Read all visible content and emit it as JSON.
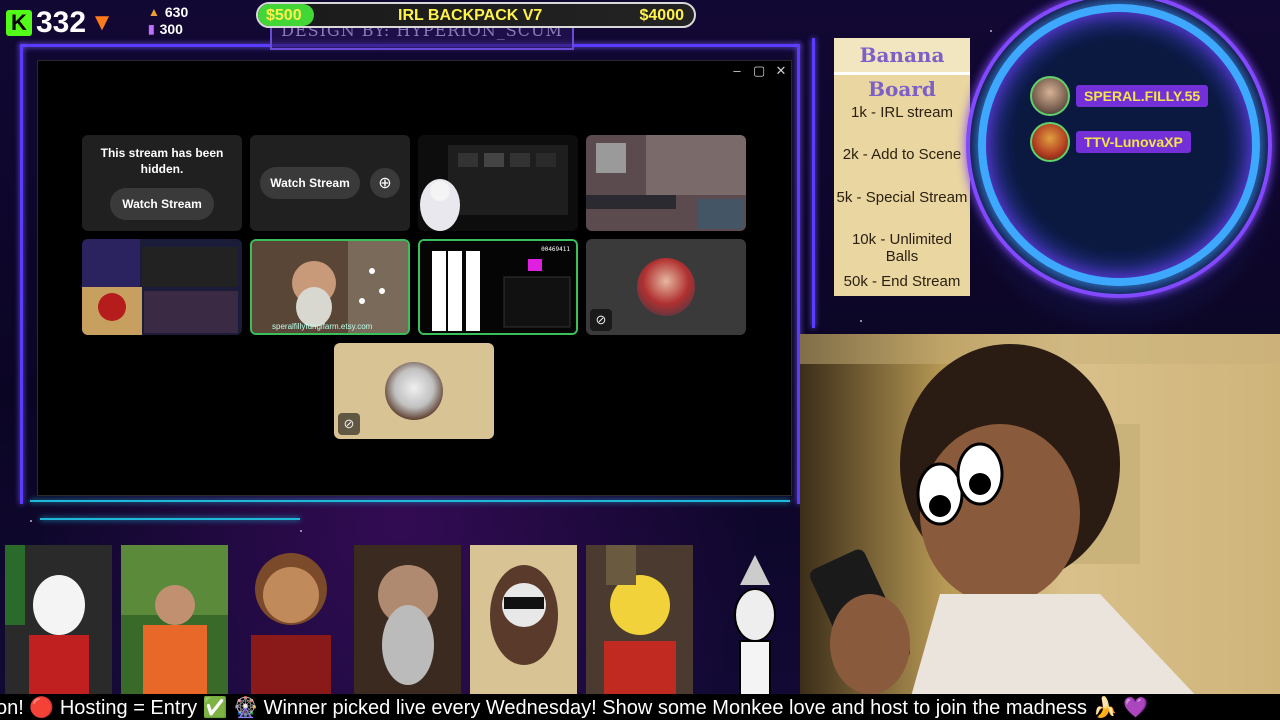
{
  "stats": {
    "kick_logo": "K",
    "viewer_count": "332",
    "trend_icon": "down-arrow",
    "stat_one": "630",
    "stat_two": "300"
  },
  "goal": {
    "start_amount": "$500",
    "title": "IRL BACKPACK V7",
    "end_amount": "$4000",
    "progress_fraction": 0.06
  },
  "credit": "DESIGN BY: HYPERION_SCUM",
  "window": {
    "controls": [
      "–",
      "▢",
      "✕"
    ],
    "hidden_tile": {
      "message": "This stream has been hidden.",
      "button_label": "Watch Stream"
    },
    "tile_two": {
      "button_label": "Watch Stream"
    },
    "etsy_caption": "speralfillyfungifarm.etsy.com",
    "overlay_number": "00469411"
  },
  "banana_board": {
    "title": "Banana Board",
    "items": [
      "1k - IRL stream",
      "2k - Add to Scene",
      "5k - Special Stream",
      "10k - Unlimited Balls",
      "50k - End Stream"
    ]
  },
  "leaderboard": [
    {
      "name": "SPERAL.FILLY.55"
    },
    {
      "name": "TTV-LunovaXP"
    }
  ],
  "ticker_text": "on! 🔴 Hosting = Entry ✅ 🎡 Winner picked live every Wednesday! Show some Monkee love and host to join the madness 🍌 💜",
  "colors": {
    "kick_green": "#53fc18",
    "goal_text": "#fff24a",
    "leaderboard_name_bg": "#7430d8",
    "leaderboard_name_text": "#f4e34a",
    "frame_purple": "#5a3cff",
    "selection_green": "#3bbf5a"
  }
}
